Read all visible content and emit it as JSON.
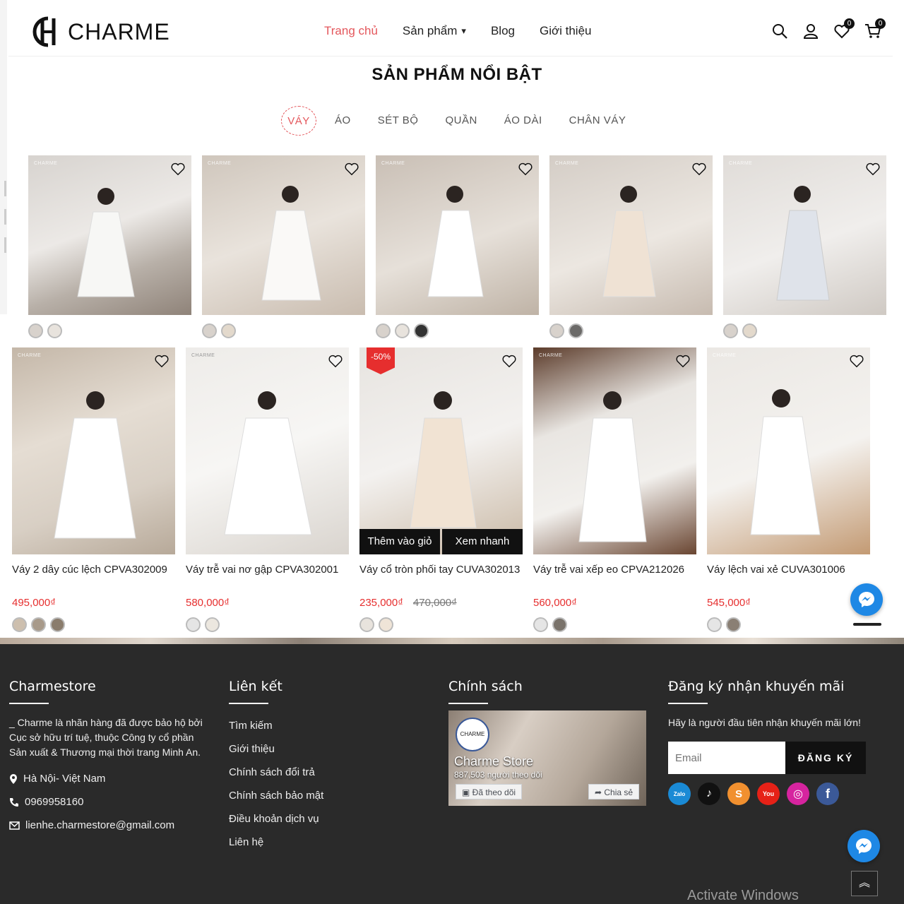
{
  "header": {
    "logo_text": "CHARME",
    "nav": [
      {
        "label": "Trang chủ",
        "active": true
      },
      {
        "label": "Sản phẩm",
        "has_dropdown": true
      },
      {
        "label": "Blog"
      },
      {
        "label": "Giới thiệu"
      }
    ],
    "wishlist_count": "0",
    "cart_count": "0"
  },
  "featured": {
    "title": "SẢN PHẨM NỔI BẬT",
    "tabs": [
      "VÁY",
      "ÁO",
      "SÉT BỘ",
      "QUẦN",
      "ÁO DÀI",
      "CHÂN VÁY"
    ],
    "active_tab": "VÁY"
  },
  "products_top": [
    {
      "brand": "CHARME",
      "swatches": 2
    },
    {
      "brand": "CHARME",
      "swatches": 2
    },
    {
      "brand": "CHARME",
      "swatches": 3
    },
    {
      "brand": "CHARME",
      "swatches": 2
    },
    {
      "brand": "CHARME",
      "swatches": 2
    }
  ],
  "products": [
    {
      "brand": "CHARME",
      "name": "Váy 2 dây cúc lệch CPVA302009",
      "price": "495,000₫",
      "swatches": 3
    },
    {
      "brand": "CHARME",
      "name": "Váy trễ vai nơ gập CPVA302001",
      "price": "580,000₫",
      "swatches": 2
    },
    {
      "brand": "CHARME",
      "name": "Váy cổ tròn phối tay CUVA302013",
      "price": "235,000₫",
      "old_price": "470,000₫",
      "sale": "-50%",
      "add_to_cart": "Thêm vào giỏ",
      "quick_view": "Xem nhanh",
      "swatches": 2
    },
    {
      "brand": "CHARME",
      "name": "Váy trễ vai xếp eo CPVA212026",
      "price": "560,000₫",
      "swatches": 2
    },
    {
      "brand": "CHARME",
      "name": "Váy lệch vai xẻ CUVA301006",
      "price": "545,000₫",
      "swatches": 2
    }
  ],
  "footer": {
    "about": {
      "title": "Charmestore",
      "text": "_ Charme là nhãn hàng đã được bảo hộ bởi Cục sở hữu trí tuệ, thuộc Công ty cổ phần Sản xuất & Thương mại thời trang Minh An.",
      "address": "Hà Nội- Việt Nam",
      "phone": "0969958160",
      "email": "lienhe.charmestore@gmail.com"
    },
    "links": {
      "title": "Liên kết",
      "items": [
        "Tìm kiếm",
        "Giới thiệu",
        "Chính sách đổi trả",
        "Chính sách bảo mật",
        "Điều khoản dịch vụ",
        "Liên hệ"
      ]
    },
    "policy": {
      "title": "Chính sách",
      "fb_logo": "CHARME",
      "fb_page_name": "Charme Store",
      "fb_followers": "887,503 người theo dõi",
      "fb_followed": "Đã theo dõi",
      "fb_share": "Chia sẻ"
    },
    "newsletter": {
      "title": "Đăng ký nhận khuyến mãi",
      "text": "Hãy là người đầu tiên nhận khuyến mãi lớn!",
      "email_placeholder": "Email",
      "button": "ĐĂNG KÝ",
      "socials": [
        {
          "name": "zalo",
          "label": "Zalo",
          "color": "#1a8ad5"
        },
        {
          "name": "tiktok",
          "label": "♪",
          "color": "#111111"
        },
        {
          "name": "shopee",
          "label": "S",
          "color": "#f1902f"
        },
        {
          "name": "youtube",
          "label": "You",
          "color": "#e62117"
        },
        {
          "name": "instagram",
          "label": "◎",
          "color": "#d6249f"
        },
        {
          "name": "facebook",
          "label": "f",
          "color": "#3b5998"
        }
      ]
    }
  },
  "watermark": "Activate Windows",
  "colors": {
    "accent": "#e4575c",
    "price": "#e62e2e",
    "footer_bg": "#2a2a2a"
  }
}
